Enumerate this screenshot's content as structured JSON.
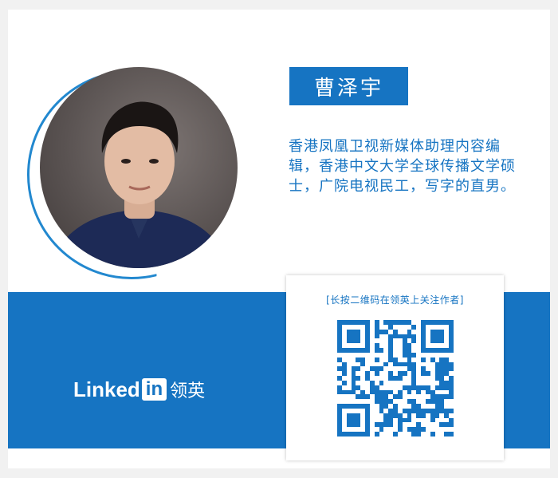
{
  "profile": {
    "name": "曹泽宇",
    "bio": "香港凤凰卫视新媒体助理内容编辑，香港中文大学全球传播文学硕士，广院电视民工，写字的直男。"
  },
  "brand": {
    "linked": "Linked",
    "in": "in",
    "cn": "领英"
  },
  "qr": {
    "caption": "[长按二维码在领英上关注作者]"
  },
  "colors": {
    "brand_blue": "#1674c2",
    "background": "#ffffff"
  }
}
